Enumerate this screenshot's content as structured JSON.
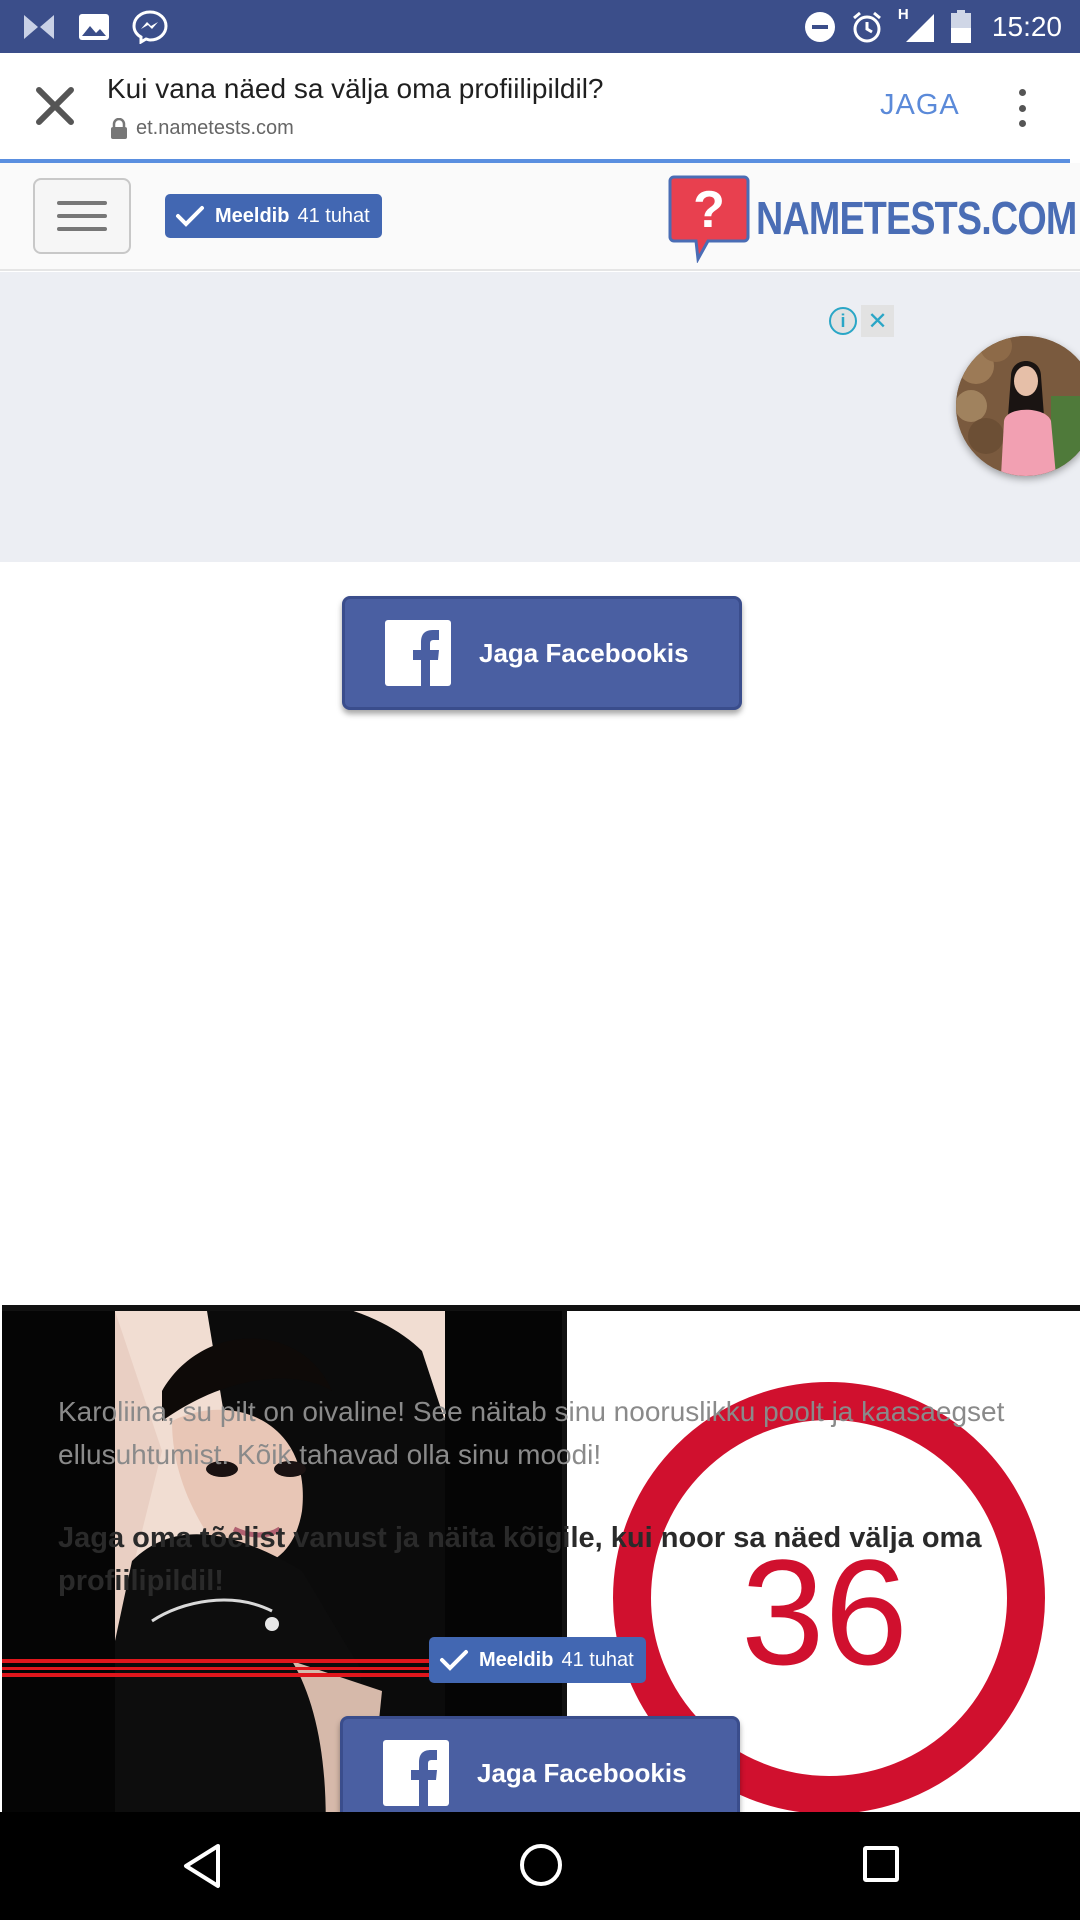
{
  "status_bar": {
    "time": "15:20",
    "network": "H"
  },
  "tab": {
    "title": "Kui vana näed sa välja oma profiilipildil?",
    "url": "et.nametests.com",
    "share_label": "JAGA"
  },
  "site_header": {
    "like_label": "Meeldib",
    "like_count": "41 tuhat",
    "logo_text": "NAMETESTS.COM"
  },
  "ad": {
    "info_icon": "i",
    "close_icon": "✕"
  },
  "card": {
    "share_button_label": "Jaga Facebookis",
    "age_result": "36",
    "description": "Karoliina, su pilt on oivaline! See näitab sinu nooruslikku poolt ja kaasaegset ellusuhtumist. Kõik tahavad olla sinu moodi!",
    "cta": "Jaga oma tõelist vanust ja näita kõigile, kui noor sa näed välja oma profiilipildil!",
    "like_label": "Meeldib",
    "like_count": "41 tuhat",
    "share_button_label_2": "Jaga Facebookis"
  },
  "colors": {
    "status_bar": "#3b4e8a",
    "facebook_blue": "#4267b2",
    "share_button": "#4a5fa2",
    "result_red": "#d0102e",
    "link_blue": "#5b8ad9"
  }
}
